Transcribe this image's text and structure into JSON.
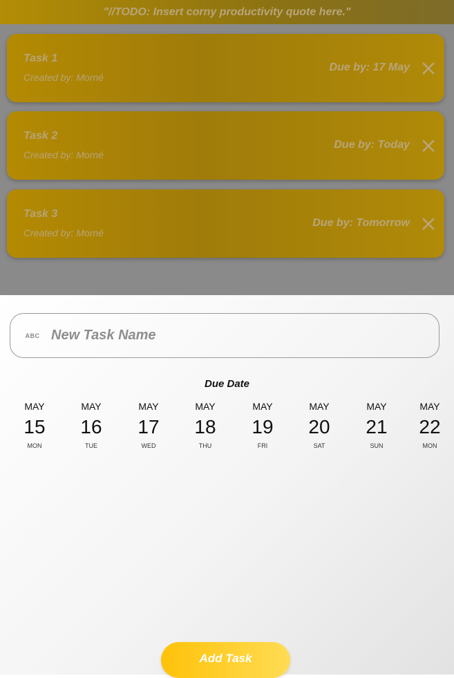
{
  "quote": "\"//TODO: Insert corny productivity quote here.\"",
  "tasks": [
    {
      "name": "Task 1",
      "created_by": "Created by: Morné",
      "due": "Due by: 17 May"
    },
    {
      "name": "Task 2",
      "created_by": "Created by: Morné",
      "due": "Due by: Today"
    },
    {
      "name": "Task 3",
      "created_by": "Created by: Morné",
      "due": "Due by: Tomorrow"
    }
  ],
  "new_task": {
    "icon": "abc-icon",
    "icon_text": "ABC",
    "placeholder": "New Task Name",
    "value": ""
  },
  "due_date_label": "Due Date",
  "dates": [
    {
      "month": "MAY",
      "day": "15",
      "dow": "MON"
    },
    {
      "month": "MAY",
      "day": "16",
      "dow": "TUE"
    },
    {
      "month": "MAY",
      "day": "17",
      "dow": "WED"
    },
    {
      "month": "MAY",
      "day": "18",
      "dow": "THU"
    },
    {
      "month": "MAY",
      "day": "19",
      "dow": "FRI"
    },
    {
      "month": "MAY",
      "day": "20",
      "dow": "SAT"
    },
    {
      "month": "MAY",
      "day": "21",
      "dow": "SUN"
    },
    {
      "month": "MAY",
      "day": "22",
      "dow": "MON"
    }
  ],
  "add_button_label": "Add Task",
  "colors": {
    "accent": "#ffc20a",
    "overlay": "#8a8a8a"
  }
}
